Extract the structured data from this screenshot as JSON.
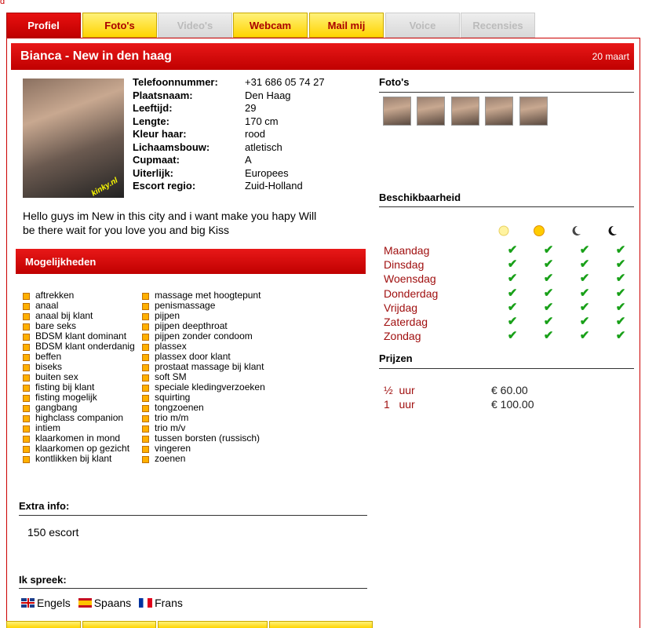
{
  "corner_text": "d",
  "tabs": [
    "Profiel",
    "Foto's",
    "Video's",
    "Webcam",
    "Mail mij",
    "Voice",
    "Recensies"
  ],
  "header": {
    "title": "Bianca - New in den haag",
    "date": "20 maart"
  },
  "photo_watermark": "kinky.nl",
  "profile": [
    {
      "k": "Telefoonnummer:",
      "v": "+31 686 05 74 27"
    },
    {
      "k": "Plaatsnaam:",
      "v": "Den Haag"
    },
    {
      "k": "Leeftijd:",
      "v": "29"
    },
    {
      "k": "Lengte:",
      "v": "170 cm"
    },
    {
      "k": "Kleur haar:",
      "v": "rood"
    },
    {
      "k": "Lichaamsbouw:",
      "v": "atletisch"
    },
    {
      "k": "Cupmaat:",
      "v": "A"
    },
    {
      "k": "Uiterlijk:",
      "v": "Europees"
    },
    {
      "k": "Escort regio:",
      "v": "Zuid-Holland"
    }
  ],
  "description": "Hello guys im New in this city and i want make you hapy Will be there wait for you love you and big Kiss",
  "mogelijkheden": {
    "title": "Mogelijkheden",
    "left": [
      "aftrekken",
      "anaal",
      "anaal bij klant",
      "bare seks",
      "BDSM klant dominant",
      "BDSM klant onderdanig",
      "beffen",
      "biseks",
      "buiten sex",
      "fisting bij klant",
      "fisting mogelijk",
      "gangbang",
      "highclass companion",
      "intiem",
      "klaarkomen in mond",
      "klaarkomen op gezicht",
      "kontlikken bij klant"
    ],
    "right": [
      "massage met hoogtepunt",
      "penismassage",
      "pijpen",
      "pijpen deepthroat",
      "pijpen zonder condoom",
      "plassex",
      "plassex door klant",
      "prostaat massage bij klant",
      "soft SM",
      "speciale kledingverzoeken",
      "squirting",
      "tongzoenen",
      "trio m/m",
      "trio m/v",
      "tussen borsten (russisch)",
      "vingeren",
      "zoenen"
    ]
  },
  "extra": {
    "label": "Extra info:",
    "value": "150 escort"
  },
  "spreek": {
    "label": "Ik spreek:",
    "langs": [
      "Engels",
      "Spaans",
      "Frans"
    ]
  },
  "fotos_label": "Foto's",
  "beschikbaarheid": {
    "label": "Beschikbaarheid",
    "days": [
      "Maandag",
      "Dinsdag",
      "Woensdag",
      "Donderdag",
      "Vrijdag",
      "Zaterdag",
      "Zondag"
    ],
    "check": "✔"
  },
  "prijzen": {
    "label": "Prijzen",
    "rows": [
      {
        "d": "½  uur",
        "p": "€ 60.00"
      },
      {
        "d": "1   uur",
        "p": "€ 100.00"
      }
    ]
  },
  "colors": {
    "red": "#cc0000",
    "yellow": "#ffd400",
    "green": "#18a018"
  }
}
